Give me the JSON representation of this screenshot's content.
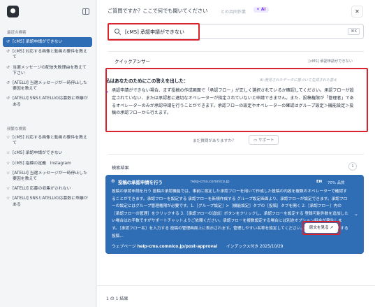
{
  "sidebar": {
    "recent_label": "最近の検索",
    "recent": [
      {
        "label": "[cMS] 承認申請ができない",
        "active": true
      },
      {
        "label": "[cMS] 対応する画像と動画の要件を教えて"
      },
      {
        "label": "当選メッセージの配信失敗理由を教えて下さい"
      },
      {
        "label": "[ATELU] 当選メッセージが一時停止した要因を教えて"
      },
      {
        "label": "[ATELU] SNSとATELUの応募数に乖離がある"
      }
    ],
    "saved_label": "频繁な検索",
    "saved": [
      {
        "label": "[cMS] 対応する画像と動画の要件を教えて"
      },
      {
        "label": "[cMS] 承認申請ができない"
      },
      {
        "label": "[cMS] 指標の定義　Instagram"
      },
      {
        "label": "[ATELU] 当選メッセージが一時停止した要因を教えて"
      },
      {
        "label": "[ATELU] 応募の収集がされない"
      },
      {
        "label": "[ATELU] SNSとATELUの応募数に乖離がある"
      }
    ]
  },
  "header": {
    "prompt": "ご質問ですか？ここで何でも聞いてください",
    "shared": "との共同作業",
    "ai_badge": "AI",
    "close": "✕"
  },
  "search": {
    "value": "[cMS] 承認申請ができない",
    "shortcut": "⌘K"
  },
  "quick_answer": {
    "title": "クイックアンサー",
    "tag": "[cMS] 承認申請ができない",
    "heading": "私はあなたのためにこの答えを出した：",
    "note": "AI-発見されたデータに基づいて生成された答え",
    "body": "承認申請ができない場合、まず投稿の作成画面で「承認フロー」が正しく選択されているか確認してください。承認フローが設定されていない、または承認者に適切なオペレーターが指定されていないと申請できません。また、投稿権限が「管理者」であるオペレーターのみが承認申請を行うことができます。承認フローの設定やオペレーターの確認はグループ設定＞機能設定＞投稿の承認フローから行えます。"
  },
  "followup": {
    "question": "まだ質問がありますか？",
    "support": "サポート"
  },
  "results": {
    "label": "検索結果",
    "count": "1",
    "items": [
      {
        "title": "投稿の承認申請を行う",
        "url": "help-cms.comnico.jp",
        "lang": "EN",
        "quality": "70% 品質",
        "body": "投稿の承認申請を行う 投稿の承認機能では、事前に設定した承認フローを用いて作成した投稿の内容を複数のオペレーターで確認することができます。承認フローを設定する 承認フローを新規作成する グループ設定画面より、承認フローが設定できます。承認フローの設定にはグループ管理権限が必要です。1.［グループ設定］>［機能設定］タブの［投稿］タブを開く 2.［承認フロー］内の［承認フローの管理］をクリックする 3.［承認フローの追加］ボタンをクリックし、承認フローを設定する 登録可能件数を追加したい場合はお手数ですがサポートチャットよりご依頼ください。承認フローを複数設定する場合には別途オプション料金が発生します。［承認フロー名］を入力する 投稿の管理画面上に表示されます。管理しやすい名称を設定してください。・［承認回数］を選択する 投稿...",
        "site_prefix": "ウェブページ",
        "site": "help-cms.comnico.jp/post-approval",
        "indexed": "インデックス付き 2025/10/29",
        "source_button": "原文を見る"
      }
    ]
  },
  "footer": {
    "count_text": "1 の 1 結果"
  }
}
